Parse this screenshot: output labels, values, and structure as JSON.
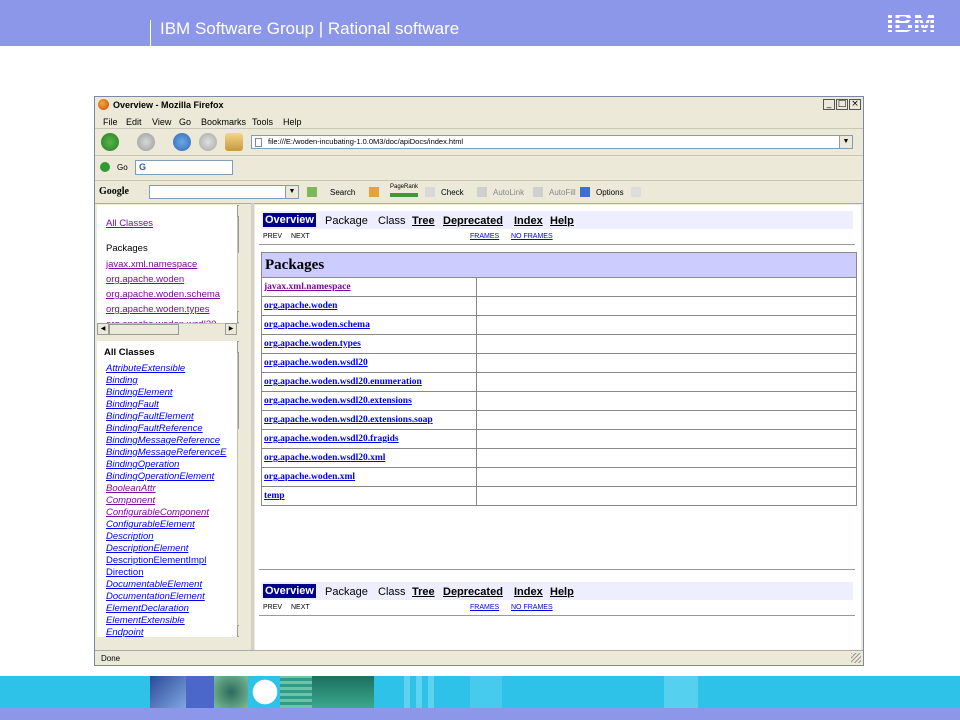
{
  "slide": {
    "header_title": "IBM Software Group | Rational software",
    "logo_text": "IBM"
  },
  "browser": {
    "window_title": "Overview - Mozilla Firefox",
    "menu": [
      "File",
      "Edit",
      "View",
      "Go",
      "Bookmarks",
      "Tools",
      "Help"
    ],
    "url": "file:///E:/woden-incubating-1.0.0M3/doc/apiDocs/index.html",
    "go_label": "Go",
    "go_box_text": "G",
    "google_toolbar": {
      "logo": "Google",
      "search_label": "Search",
      "pagerank_label": "PageRank",
      "check_label": "Check",
      "autolink_label": "AutoLink",
      "autofill_label": "AutoFill",
      "options_label": "Options"
    },
    "status": "Done"
  },
  "left_top_frame": {
    "all_classes_link": "All Classes",
    "packages_heading": "Packages",
    "packages": [
      "javax.xml.namespace",
      "org.apache.woden",
      "org.apache.woden.schema",
      "org.apache.woden.types",
      "org.apache.woden.wsdl20"
    ]
  },
  "left_bottom_frame": {
    "heading": "All Classes",
    "classes": [
      {
        "name": "AttributeExtensible",
        "italic": true
      },
      {
        "name": "Binding",
        "italic": true
      },
      {
        "name": "BindingElement",
        "italic": true
      },
      {
        "name": "BindingFault",
        "italic": true
      },
      {
        "name": "BindingFaultElement",
        "italic": true
      },
      {
        "name": "BindingFaultReference",
        "italic": true
      },
      {
        "name": "BindingMessageReference",
        "italic": true
      },
      {
        "name": "BindingMessageReferenceE",
        "italic": true
      },
      {
        "name": "BindingOperation",
        "italic": true
      },
      {
        "name": "BindingOperationElement",
        "italic": true
      },
      {
        "name": "BooleanAttr",
        "italic": true
      },
      {
        "name": "Component",
        "italic": true
      },
      {
        "name": "ConfigurableComponent",
        "italic": true
      },
      {
        "name": "ConfigurableElement",
        "italic": true
      },
      {
        "name": "Description",
        "italic": true
      },
      {
        "name": "DescriptionElement",
        "italic": true
      },
      {
        "name": "DescriptionElementImpl",
        "italic": false
      },
      {
        "name": "Direction",
        "italic": false
      },
      {
        "name": "DocumentableElement",
        "italic": true
      },
      {
        "name": "DocumentationElement",
        "italic": true
      },
      {
        "name": "ElementDeclaration",
        "italic": true
      },
      {
        "name": "ElementExtensible",
        "italic": true
      },
      {
        "name": "Endpoint",
        "italic": true
      }
    ]
  },
  "main_frame": {
    "nav": {
      "overview": "Overview",
      "package": "Package",
      "class": "Class",
      "tree": "Tree",
      "deprecated": "Deprecated",
      "index": "Index",
      "help": "Help",
      "prev": "PREV",
      "next": "NEXT",
      "frames": "FRAMES",
      "no_frames": "NO FRAMES"
    },
    "table_heading": "Packages",
    "packages": [
      "javax.xml.namespace",
      "org.apache.woden",
      "org.apache.woden.schema",
      "org.apache.woden.types",
      "org.apache.woden.wsdl20",
      "org.apache.woden.wsdl20.enumeration",
      "org.apache.woden.wsdl20.extensions",
      "org.apache.woden.wsdl20.extensions.soap",
      "org.apache.woden.wsdl20.fragids",
      "org.apache.woden.wsdl20.xml",
      "org.apache.woden.xml",
      "temp"
    ]
  },
  "colors": {
    "slide_header": "#8c97e9",
    "slide_footer": "#2ec2e8",
    "javadoc_nav_bg": "#eeeeff",
    "javadoc_table_header": "#ccccff",
    "overview_highlight": "#00008b"
  }
}
